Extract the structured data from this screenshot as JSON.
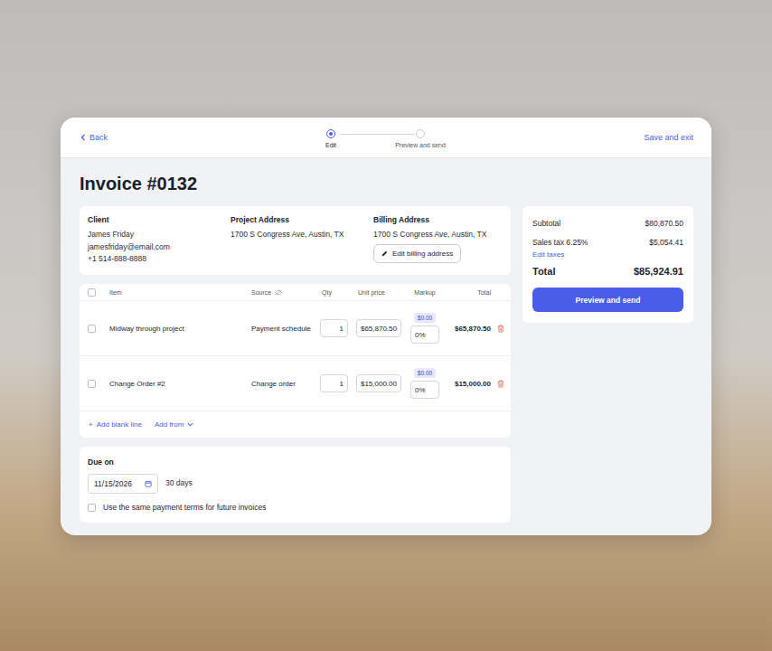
{
  "header": {
    "back": "Back",
    "steps": [
      {
        "label": "Edit",
        "selected": true
      },
      {
        "label": "Preview and send",
        "selected": false
      }
    ],
    "save": "Save and exit"
  },
  "title": "Invoice #0132",
  "info": {
    "client": {
      "label": "Client",
      "name": "James Friday",
      "email": "jamesfriday@email.com",
      "phone": "+1 514-888-8888"
    },
    "project": {
      "label": "Project Address",
      "address": "1700 S Congress Ave, Austin, TX"
    },
    "billing": {
      "label": "Billing Address",
      "address": "1700 S Congress Ave, Austin, TX",
      "edit": "Edit billing address"
    }
  },
  "table": {
    "select_all_checked": false,
    "columns": [
      "Item",
      "Source",
      "Qty",
      "Unit price",
      "Markup",
      "Total"
    ],
    "rows": [
      {
        "checked": false,
        "item": "Midway through project",
        "source": "Payment schedule",
        "qty": "1",
        "unit_price": "$65,870.50",
        "markup_amount": "$0.00",
        "markup": "0%",
        "total": "$65,870.50"
      },
      {
        "checked": false,
        "item": "Change Order #2",
        "source": "Change order",
        "qty": "1",
        "unit_price": "$15,000.00",
        "markup_amount": "$0.00",
        "markup": "0%",
        "total": "$15,000.00"
      }
    ],
    "add_blank_icon": "+",
    "add_blank": "Add blank line",
    "add_from": "Add from"
  },
  "due": {
    "label": "Due on",
    "date": "11/15/2026",
    "days": "30 days",
    "same_terms": {
      "label": "Use the same payment terms for future invoices",
      "checked": false
    }
  },
  "summary": {
    "rows": [
      {
        "label": "Subtotal",
        "value": "$80,870.50"
      },
      {
        "label": "Sales tax 6.25%",
        "value": "$5,054.41"
      }
    ],
    "edit_taxes": "Edit taxes",
    "total": {
      "label": "Total",
      "value": "$85,924.91"
    },
    "button": "Preview and send"
  }
}
